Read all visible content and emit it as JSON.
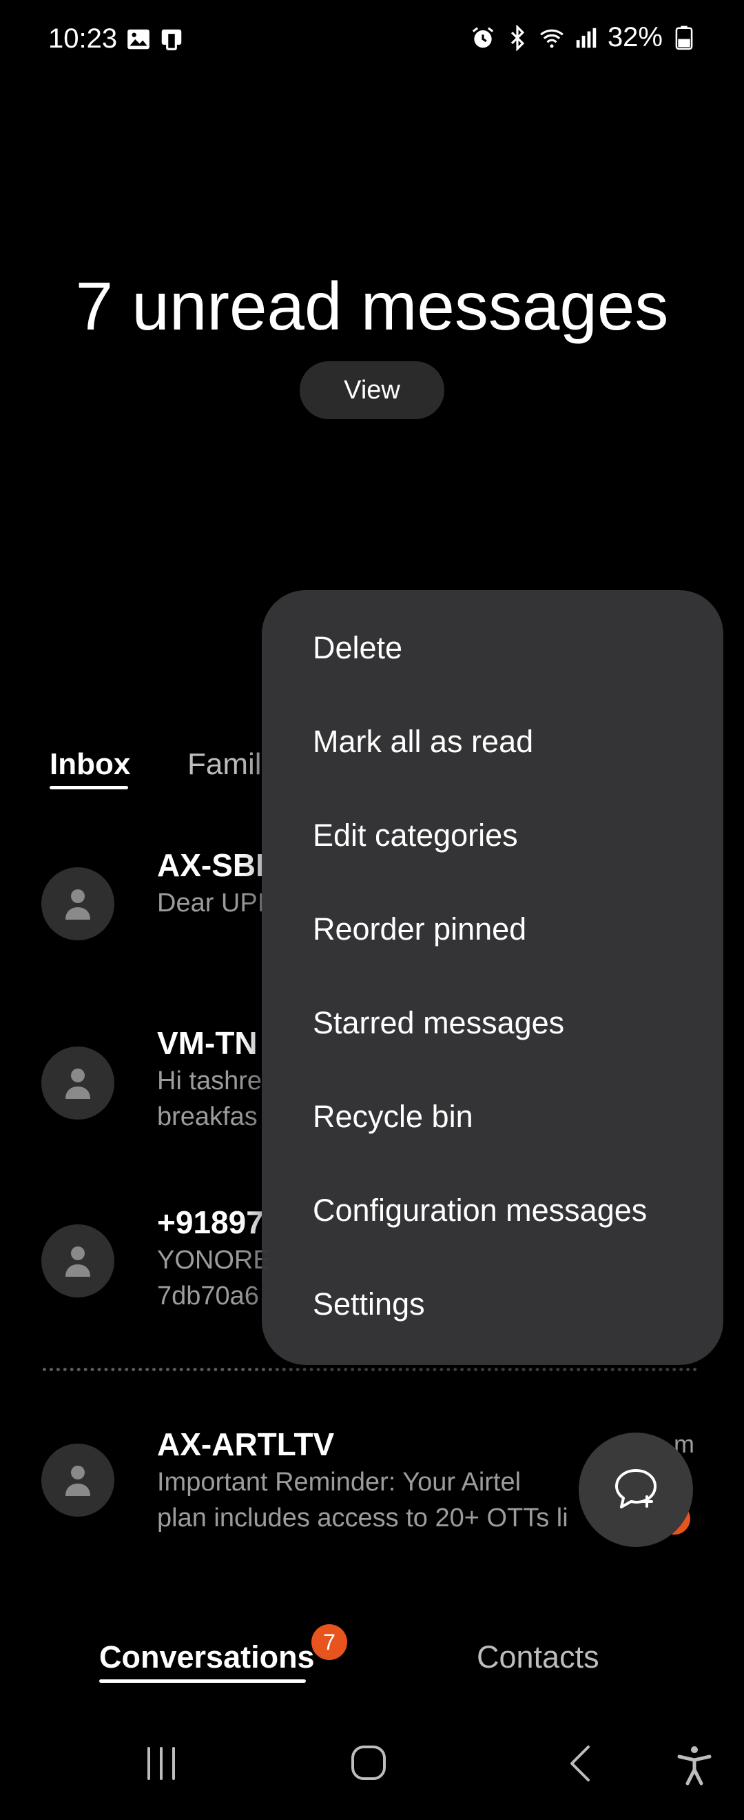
{
  "status_bar": {
    "time": "10:23",
    "battery": "32%",
    "icons": [
      "gallery-icon",
      "notification-app-icon",
      "alarm-icon",
      "bluetooth-icon",
      "wifi-icon",
      "signal-icon",
      "battery-icon"
    ]
  },
  "header": {
    "unread_title": "7 unread messages",
    "view_label": "View"
  },
  "tabs": {
    "inbox": "Inbox",
    "family": "Famil"
  },
  "conversations": [
    {
      "name": "AX-SBI",
      "preview_line1": "Dear UPI",
      "preview_line2": ""
    },
    {
      "name": "VM-TN",
      "preview_line1": "Hi tashre",
      "preview_line2": "breakfas"
    },
    {
      "name": "+91897",
      "preview_line1": "YONORE",
      "preview_line2": "7db70a6"
    },
    {
      "name": "AX-ARTLTV",
      "time": "4:_m",
      "preview_line1": "Important Reminder: Your Airtel",
      "preview_line2": "plan includes access to 20+ OTTs li"
    }
  ],
  "menu": {
    "items": [
      "Delete",
      "Mark all as read",
      "Edit categories",
      "Reorder pinned",
      "Starred messages",
      "Recycle bin",
      "Configuration messages",
      "Settings"
    ]
  },
  "bottom_nav": {
    "conversations": "Conversations",
    "badge": "7",
    "contacts": "Contacts"
  },
  "colors": {
    "background": "#000000",
    "menu_bg": "#363638",
    "accent_badge": "#e8541d",
    "secondary_text": "#9c9c9c"
  }
}
